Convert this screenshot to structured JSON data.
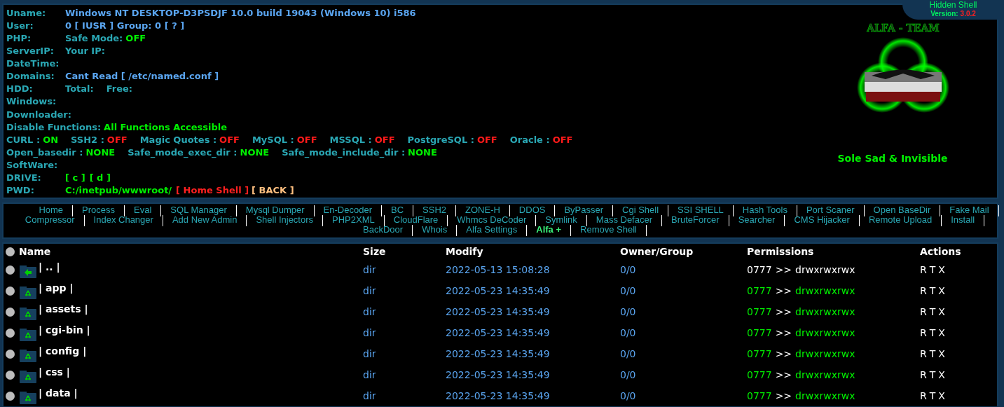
{
  "badge": {
    "title": "Hidden Shell",
    "version_label": "Version:",
    "version": "3.0.2"
  },
  "info": [
    {
      "parts": [
        {
          "kind": "key",
          "text": "Uname:"
        },
        {
          "kind": "value",
          "text": "Windows NT DESKTOP-D3PSDJF 10.0 build 19043 (Windows 10) i586"
        }
      ]
    },
    {
      "parts": [
        {
          "kind": "key",
          "text": "User:"
        },
        {
          "kind": "value",
          "text": "0 [ IUSR ] Group: 0 [ ? ]"
        }
      ]
    },
    {
      "parts": [
        {
          "kind": "key",
          "text": "PHP:"
        },
        {
          "kind": "label",
          "text": "Safe Mode:"
        },
        {
          "kind": "on",
          "text": "OFF"
        }
      ]
    },
    {
      "parts": [
        {
          "kind": "key",
          "text": "ServerIP:"
        },
        {
          "kind": "label",
          "text": "Your IP:"
        }
      ]
    },
    {
      "parts": [
        {
          "kind": "key",
          "text": "DateTime:"
        }
      ]
    },
    {
      "parts": [
        {
          "kind": "key",
          "text": "Domains:"
        },
        {
          "kind": "value",
          "text": "Cant Read [ /etc/named.conf ]"
        }
      ]
    },
    {
      "parts": [
        {
          "kind": "key",
          "text": "HDD:"
        },
        {
          "kind": "label",
          "text": "Total:"
        },
        {
          "kind": "label",
          "text": "Free:"
        }
      ]
    },
    {
      "parts": [
        {
          "kind": "key",
          "text": "Windows:"
        }
      ]
    },
    {
      "parts": [
        {
          "kind": "key",
          "text": "Downloader:"
        }
      ]
    },
    {
      "parts": [
        {
          "kind": "label",
          "text": "Disable Functions:"
        },
        {
          "kind": "on",
          "text": "All Functions Accessible"
        }
      ]
    },
    {
      "parts": [
        {
          "kind": "label",
          "text": "CURL :"
        },
        {
          "kind": "on",
          "text": "ON"
        },
        {
          "kind": "label",
          "text": "SSH2 :"
        },
        {
          "kind": "off",
          "text": "OFF"
        },
        {
          "kind": "label",
          "text": "Magic Quotes :"
        },
        {
          "kind": "off",
          "text": "OFF"
        },
        {
          "kind": "label",
          "text": "MySQL :"
        },
        {
          "kind": "off",
          "text": "OFF"
        },
        {
          "kind": "label",
          "text": "MSSQL :"
        },
        {
          "kind": "off",
          "text": "OFF"
        },
        {
          "kind": "label",
          "text": "PostgreSQL :"
        },
        {
          "kind": "off",
          "text": "OFF"
        },
        {
          "kind": "label",
          "text": "Oracle :"
        },
        {
          "kind": "off",
          "text": "OFF"
        }
      ]
    },
    {
      "parts": [
        {
          "kind": "label",
          "text": "Open_basedir :"
        },
        {
          "kind": "on",
          "text": "NONE"
        },
        {
          "kind": "label",
          "text": "Safe_mode_exec_dir :"
        },
        {
          "kind": "on",
          "text": "NONE"
        },
        {
          "kind": "label",
          "text": "Safe_mode_include_dir :"
        },
        {
          "kind": "on",
          "text": "NONE"
        }
      ]
    },
    {
      "parts": [
        {
          "kind": "key",
          "text": "SoftWare:"
        }
      ]
    },
    {
      "parts": [
        {
          "kind": "key",
          "text": "DRIVE:"
        },
        {
          "kind": "link",
          "text": "[ c ]"
        },
        {
          "kind": "link",
          "text": "[ d ]"
        }
      ]
    },
    {
      "parts": [
        {
          "kind": "key",
          "text": "PWD:"
        },
        {
          "kind": "link",
          "text": "C:/inetpub/wwwroot/"
        },
        {
          "kind": "home",
          "text": "[ Home Shell ]"
        },
        {
          "kind": "back",
          "text": "[ BACK ]"
        }
      ]
    }
  ],
  "logo": {
    "text": "ALFA - TEAM"
  },
  "motto": "Sole Sad & Invisible",
  "menu": [
    [
      {
        "label": "Home",
        "selected": false
      },
      {
        "label": "Process",
        "selected": false
      },
      {
        "label": "Eval",
        "selected": false
      },
      {
        "label": "SQL Manager",
        "selected": false
      },
      {
        "label": "Mysql Dumper",
        "selected": false
      },
      {
        "label": "En-Decoder",
        "selected": false
      },
      {
        "label": "BC",
        "selected": false
      },
      {
        "label": "SSH2",
        "selected": false
      },
      {
        "label": "ZONE-H",
        "selected": false
      },
      {
        "label": "DDOS",
        "selected": false
      },
      {
        "label": "ByPasser",
        "selected": false
      },
      {
        "label": "Cgi Shell",
        "selected": false
      },
      {
        "label": "SSI SHELL",
        "selected": false
      },
      {
        "label": "Hash Tools",
        "selected": false
      },
      {
        "label": "Port Scaner",
        "selected": false
      },
      {
        "label": "Open BaseDir",
        "selected": false
      },
      {
        "label": "Fake Mail",
        "selected": false
      }
    ],
    [
      {
        "label": "Compressor",
        "selected": false
      },
      {
        "label": "Index Changer",
        "selected": false
      },
      {
        "label": "Add New Admin",
        "selected": false
      },
      {
        "label": "Shell Injectors",
        "selected": false
      },
      {
        "label": "PHP2XML",
        "selected": false
      },
      {
        "label": "CloudFlare",
        "selected": false
      },
      {
        "label": "Whmcs DeCoder",
        "selected": false
      },
      {
        "label": "Symlink",
        "selected": false
      },
      {
        "label": "Mass Defacer",
        "selected": false
      },
      {
        "label": "BruteForcer",
        "selected": false
      },
      {
        "label": "Searcher",
        "selected": false
      },
      {
        "label": "CMS Hijacker",
        "selected": false
      },
      {
        "label": "Remote Upload",
        "selected": false
      },
      {
        "label": "Install",
        "selected": false
      }
    ],
    [
      {
        "label": "BackDoor",
        "selected": false
      },
      {
        "label": "Whois",
        "selected": false
      },
      {
        "label": "Alfa Settings",
        "selected": false
      },
      {
        "label": "Alfa +",
        "selected": true
      },
      {
        "label": "Remove Shell",
        "selected": false
      }
    ]
  ],
  "table": {
    "select_all": {
      "selected": false
    },
    "columns": [
      "Name",
      "Size",
      "Modify",
      "Owner/Group",
      "Permissions",
      "Actions"
    ],
    "rows": [
      {
        "kind": "parent",
        "selected": false,
        "name": "| .. |",
        "size": "dir",
        "modify": "2022-05-13 15:08:28",
        "owner": "0/0",
        "perm_code": "0777",
        "perm_sep": ">>",
        "perm_string": "drwxrwxrwx",
        "writable": false,
        "actions": [
          "R",
          "T",
          "X"
        ]
      },
      {
        "kind": "folder",
        "selected": false,
        "name": "| app |",
        "size": "dir",
        "modify": "2022-05-23 14:35:49",
        "owner": "0/0",
        "perm_code": "0777",
        "perm_sep": ">>",
        "perm_string": "drwxrwxrwx",
        "writable": true,
        "actions": [
          "R",
          "T",
          "X"
        ]
      },
      {
        "kind": "folder",
        "selected": false,
        "name": "| assets |",
        "size": "dir",
        "modify": "2022-05-23 14:35:49",
        "owner": "0/0",
        "perm_code": "0777",
        "perm_sep": ">>",
        "perm_string": "drwxrwxrwx",
        "writable": true,
        "actions": [
          "R",
          "T",
          "X"
        ]
      },
      {
        "kind": "folder",
        "selected": false,
        "name": "| cgi-bin |",
        "size": "dir",
        "modify": "2022-05-23 14:35:49",
        "owner": "0/0",
        "perm_code": "0777",
        "perm_sep": ">>",
        "perm_string": "drwxrwxrwx",
        "writable": true,
        "actions": [
          "R",
          "T",
          "X"
        ]
      },
      {
        "kind": "folder",
        "selected": false,
        "name": "| config |",
        "size": "dir",
        "modify": "2022-05-23 14:35:49",
        "owner": "0/0",
        "perm_code": "0777",
        "perm_sep": ">>",
        "perm_string": "drwxrwxrwx",
        "writable": true,
        "actions": [
          "R",
          "T",
          "X"
        ]
      },
      {
        "kind": "folder",
        "selected": false,
        "name": "| css |",
        "size": "dir",
        "modify": "2022-05-23 14:35:49",
        "owner": "0/0",
        "perm_code": "0777",
        "perm_sep": ">>",
        "perm_string": "drwxrwxrwx",
        "writable": true,
        "actions": [
          "R",
          "T",
          "X"
        ]
      },
      {
        "kind": "folder",
        "selected": false,
        "name": "| data |",
        "size": "dir",
        "modify": "2022-05-23 14:35:49",
        "owner": "0/0",
        "perm_code": "0777",
        "perm_sep": ">>",
        "perm_string": "drwxrwxrwx",
        "writable": true,
        "actions": [
          "R",
          "T",
          "X"
        ]
      }
    ]
  }
}
